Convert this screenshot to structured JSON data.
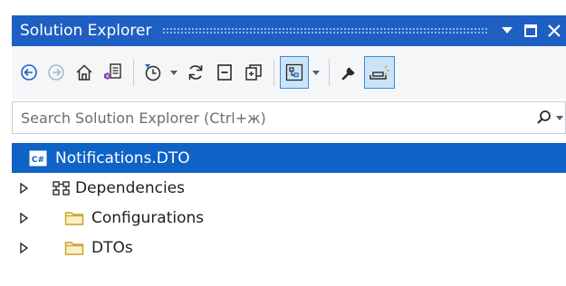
{
  "window": {
    "title": "Solution Explorer",
    "buttons": [
      "dropdown-arrow-icon",
      "maximize-icon",
      "close-icon"
    ]
  },
  "toolbar": {
    "icons": [
      "back-arrow-icon",
      "forward-arrow-icon",
      "home-icon",
      "switch-views-icon",
      "pending-changes-filter-icon",
      "sync-refresh-icon",
      "collapse-all-icon",
      "show-all-files-icon",
      "preview-selected-items-icon",
      "properties-wrench-icon",
      "preview-pane-icon"
    ],
    "active_button": "preview-pane-icon"
  },
  "search": {
    "placeholder": "Search Solution Explorer (Ctrl+ж)"
  },
  "tree": {
    "project": {
      "label": "Notifications.DTO",
      "icon": "csharp-project-icon",
      "selected": true
    },
    "items": [
      {
        "label": "Dependencies",
        "icon": "dependencies-icon"
      },
      {
        "label": "Configurations",
        "icon": "folder-icon"
      },
      {
        "label": "DTOs",
        "icon": "folder-icon"
      }
    ]
  },
  "colors": {
    "titlebar": "#1e5fc3",
    "selection": "#0f62c6",
    "toolbar_bg": "#f5f6f7",
    "accent_purple": "#7b3fb0",
    "icon_dark": "#2b2b2b",
    "folder_yellow": "#c9a227"
  }
}
